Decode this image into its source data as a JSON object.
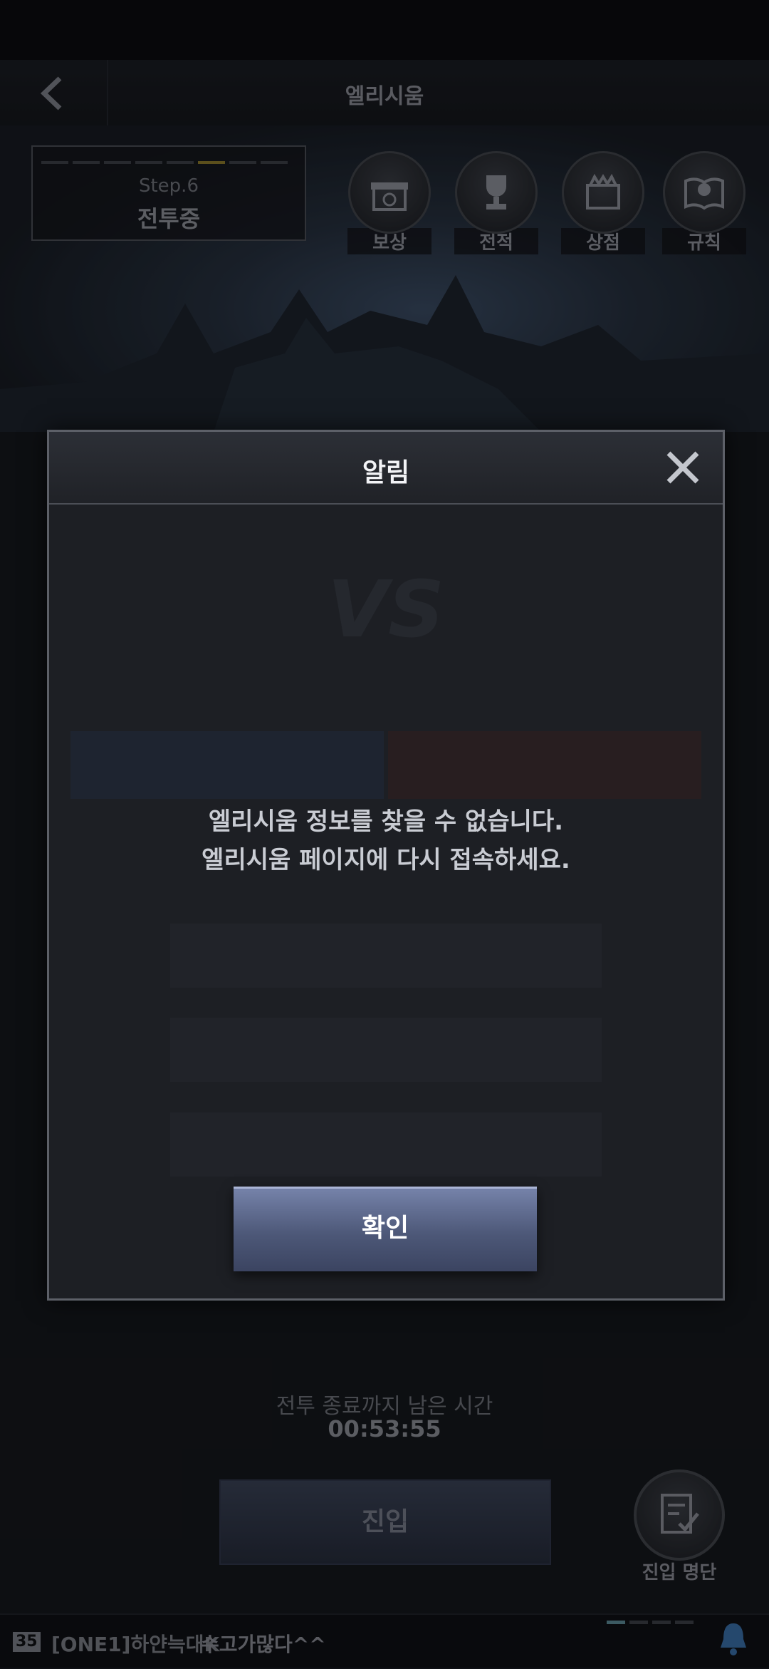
{
  "header": {
    "title": "엘리시움"
  },
  "step": {
    "label": "Step.6",
    "status": "전투중"
  },
  "menu": [
    {
      "label": "보상",
      "icon": "gift-icon"
    },
    {
      "label": "전적",
      "icon": "trophy-icon"
    },
    {
      "label": "상점",
      "icon": "shop-icon"
    },
    {
      "label": "규칙",
      "icon": "rules-book-icon"
    }
  ],
  "countdown": {
    "label": "전투 종료까지 남은 시간",
    "value": "00:53:55"
  },
  "enter_button": {
    "label": "진입"
  },
  "roster_button": {
    "label": "진입 명단"
  },
  "chat": {
    "level": "35",
    "sender": "[ONE1]하얀늑대K",
    "message": "수고가많다^^"
  },
  "modal": {
    "title": "알림",
    "message_line1": "엘리시움 정보를 찾을 수 없습니다.",
    "message_line2": "엘리시움 페이지에 다시 접속하세요.",
    "confirm_label": "확인"
  },
  "colors": {
    "confirm_button": "#4d5878",
    "modal_bg": "#1d1f24",
    "accent_bell": "#3a6fa8"
  }
}
